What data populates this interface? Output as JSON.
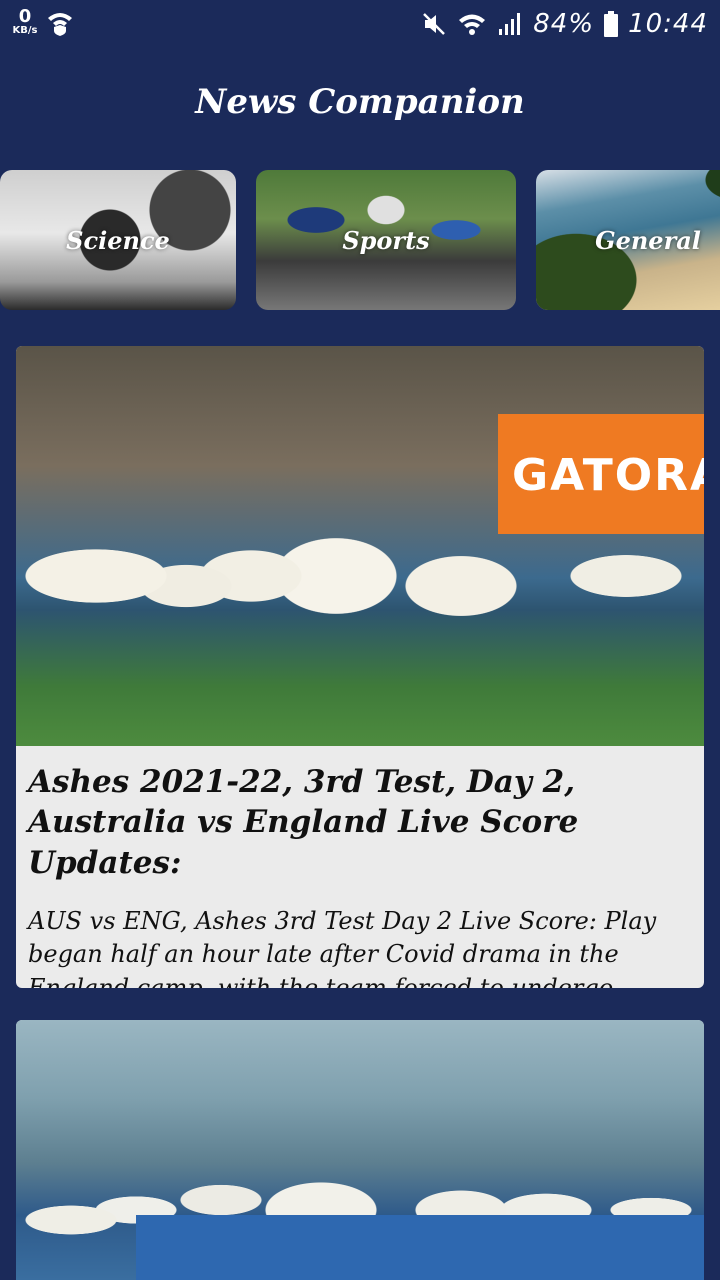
{
  "status_bar": {
    "net_speed": "0",
    "net_unit": "KB/s",
    "battery": "84%",
    "time": "10:44",
    "icons": [
      "wifi-shield-icon",
      "mute-icon",
      "wifi-icon",
      "signal-icon",
      "battery-icon"
    ]
  },
  "header": {
    "title": "News Companion"
  },
  "categories": [
    {
      "label": "Science",
      "icon": "microscope-image"
    },
    {
      "label": "Sports",
      "icon": "cyclists-image"
    },
    {
      "label": "General",
      "icon": "beach-image"
    }
  ],
  "articles": [
    {
      "title": "Ashes 2021-22, 3rd Test, Day 2, Australia vs England Live Score Updates:",
      "description": "AUS vs ENG, Ashes 3rd Test Day 2 Live Score: Play began half an hour late after Covid drama in the England camp, with the team forced to undergo",
      "banner_text": "GATORA"
    },
    {
      "title": "",
      "description": ""
    }
  ],
  "colors": {
    "background": "#1b2a5a",
    "card": "#ebebeb",
    "text": "#111111"
  }
}
